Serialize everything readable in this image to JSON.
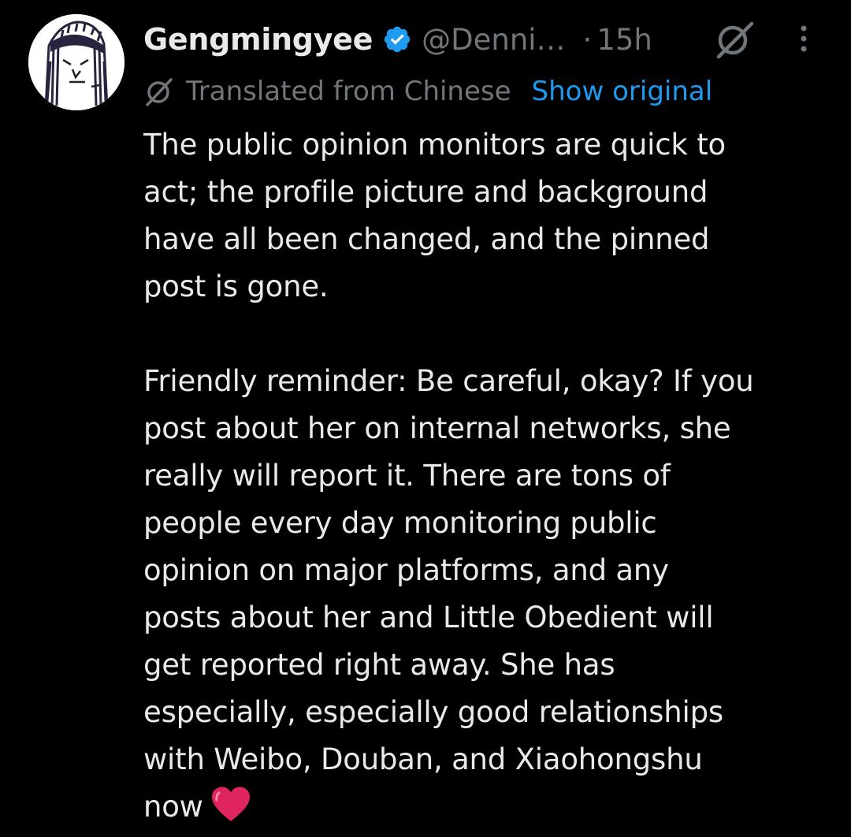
{
  "post": {
    "author": {
      "display_name": "Gengmingyee",
      "handle": "@Denni…",
      "verified": true,
      "avatar_icon": "hand-drawn-face-avatar"
    },
    "separator": "·",
    "time": "15h",
    "header_icons": [
      "grok-icon",
      "more-options-icon"
    ],
    "translation": {
      "icon": "translate-icon",
      "label": "Translated from Chinese",
      "action": "Show original"
    },
    "body": {
      "paragraph_1": [
        "The public opinion monitors are quick to",
        "act; the profile picture and background",
        "have all been changed, and the pinned",
        "post is gone."
      ],
      "paragraph_2": [
        "Friendly reminder: Be careful, okay? If you",
        "post about her on internal networks, she",
        "really will report it. There are tons of",
        "people every day monitoring public",
        "opinion on major platforms, and any",
        "posts about her and Little Obedient will",
        "get reported right away. She has",
        "especially, especially good relationships",
        "with Weibo, Douban, and Xiaohongshu",
        "now"
      ],
      "end_emoji": "red-heart-emoji"
    }
  },
  "colors": {
    "background": "#000000",
    "primary_text": "#e7e9ea",
    "secondary_text": "#71767b",
    "link": "#1d9bf0",
    "verified_badge": "#1d9bf0",
    "heart": "#e0245e"
  }
}
